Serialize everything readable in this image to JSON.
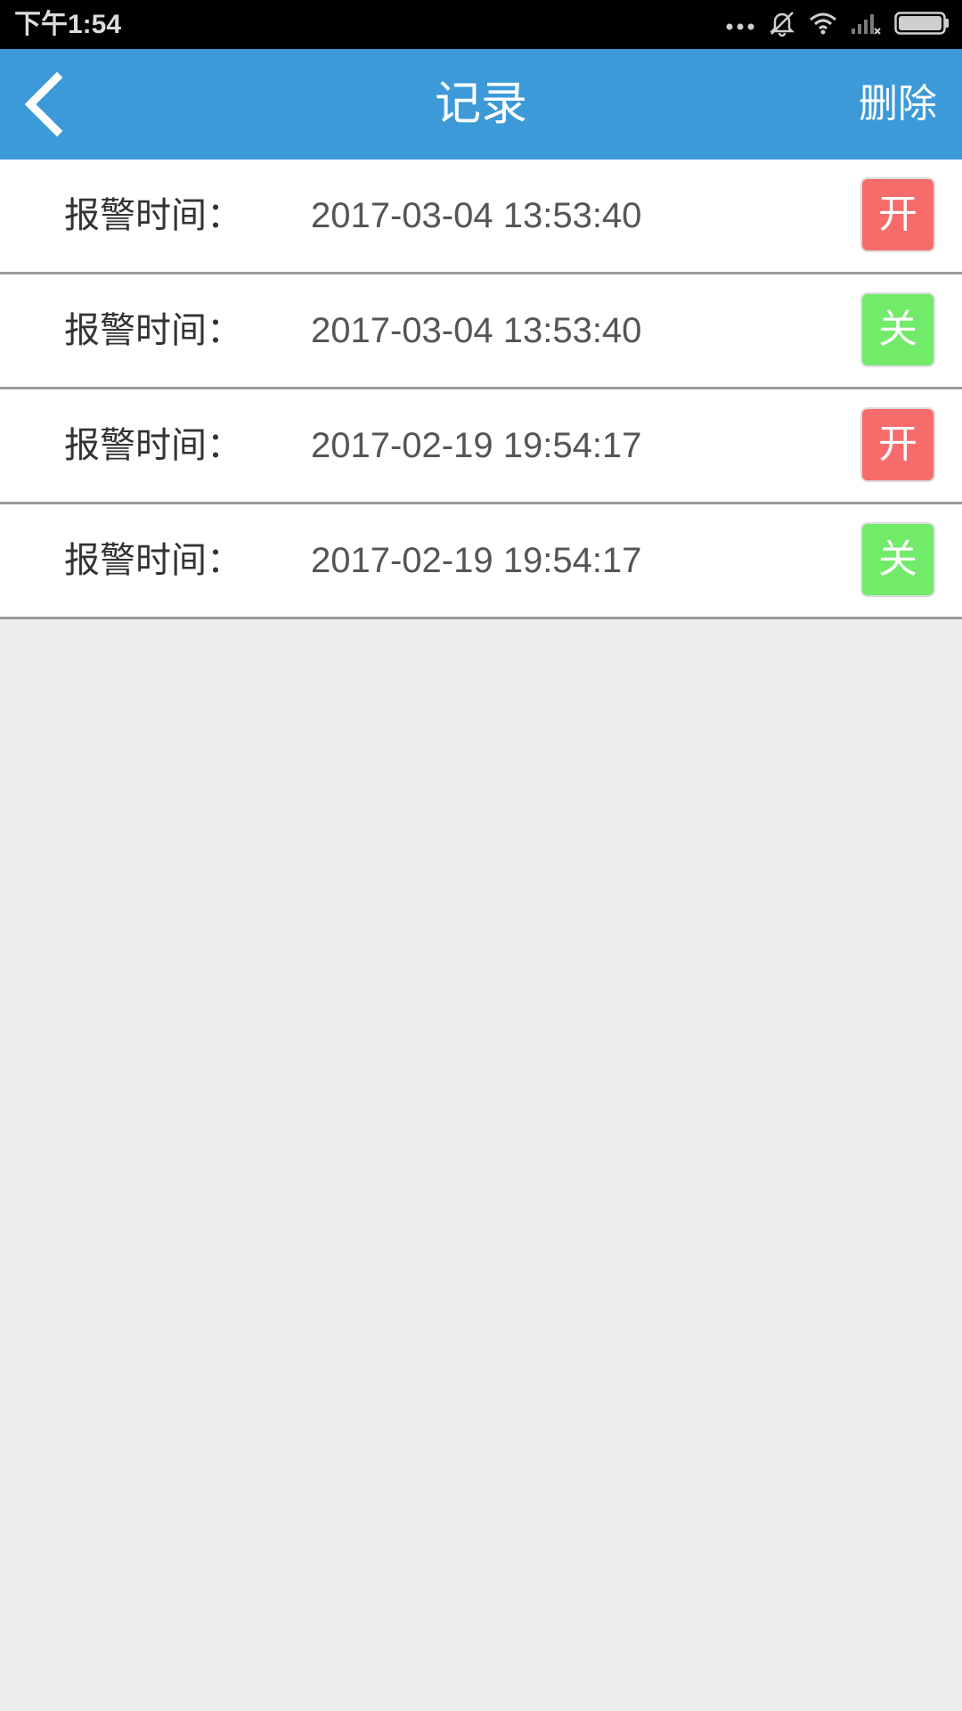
{
  "status_bar": {
    "time": "下午1:54",
    "icons": [
      "more-dots-icon",
      "silent-bell-icon",
      "wifi-icon",
      "signal-icon",
      "battery-icon"
    ]
  },
  "header": {
    "title": "记录",
    "delete_label": "删除",
    "back_icon": "chevron-left-icon",
    "background_color": "#3c9ad8"
  },
  "records": [
    {
      "label": "报警时间：",
      "time": "2017-03-04 13:53:40",
      "state": "开",
      "state_color": "#f76b6b"
    },
    {
      "label": "报警时间：",
      "time": "2017-03-04 13:53:40",
      "state": "关",
      "state_color": "#72ea6a"
    },
    {
      "label": "报警时间：",
      "time": "2017-02-19 19:54:17",
      "state": "开",
      "state_color": "#f76b6b"
    },
    {
      "label": "报警时间：",
      "time": "2017-02-19 19:54:17",
      "state": "关",
      "state_color": "#72ea6a"
    }
  ]
}
